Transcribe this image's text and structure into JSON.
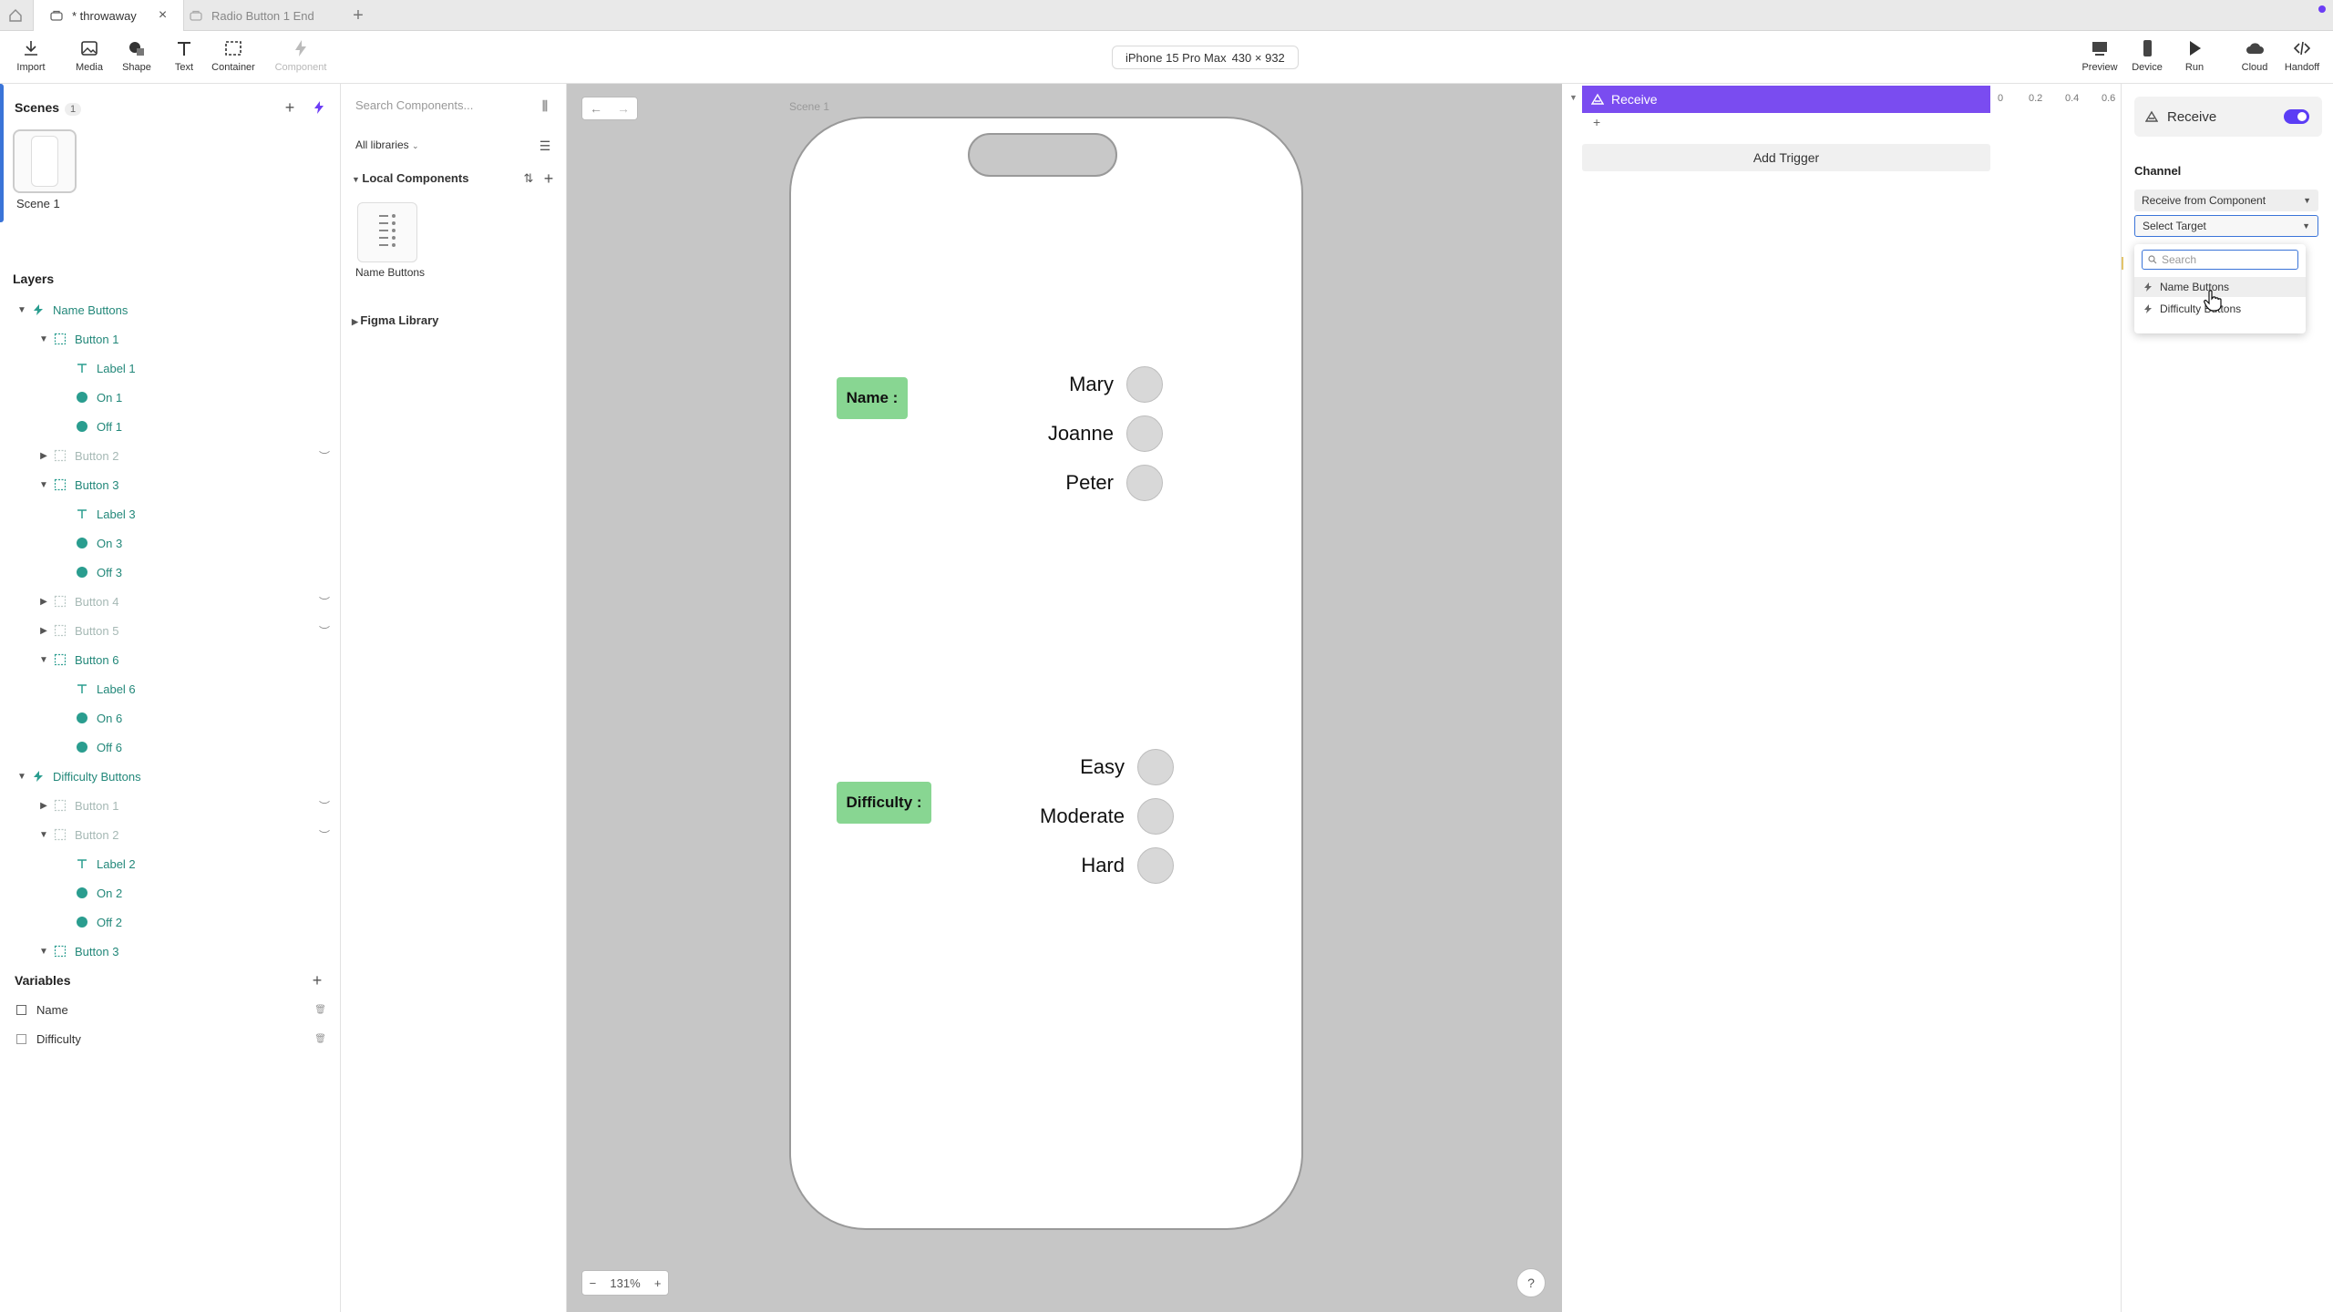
{
  "tabs": [
    {
      "label": "* throwaway",
      "active": true
    },
    {
      "label": "Radio Button 1 End",
      "active": false
    }
  ],
  "toolbar": {
    "tools": [
      "Import",
      "Media",
      "Shape",
      "Text",
      "Container",
      "Component"
    ],
    "device_name": "iPhone 15 Pro Max",
    "device_size": "430 × 932",
    "right_tools": [
      "Preview",
      "Device",
      "Run",
      "Cloud",
      "Handoff"
    ]
  },
  "scenes": {
    "title": "Scenes",
    "count": "1",
    "items": [
      "Scene 1"
    ]
  },
  "layers": {
    "title": "Layers",
    "rows": [
      {
        "name": "Name Buttons",
        "type": "component",
        "indent": 0,
        "expanded": true,
        "dim": false
      },
      {
        "name": "Button 1",
        "type": "frame",
        "indent": 1,
        "expanded": true,
        "dim": false
      },
      {
        "name": "Label 1",
        "type": "text",
        "indent": 2,
        "dim": false
      },
      {
        "name": "On 1",
        "type": "shape",
        "indent": 2,
        "dim": false
      },
      {
        "name": "Off 1",
        "type": "shape",
        "indent": 2,
        "dim": false
      },
      {
        "name": "Button 2",
        "type": "frame",
        "indent": 1,
        "expanded": false,
        "dim": true,
        "hidden": true
      },
      {
        "name": "Button 3",
        "type": "frame",
        "indent": 1,
        "expanded": true,
        "dim": false
      },
      {
        "name": "Label 3",
        "type": "text",
        "indent": 2,
        "dim": false
      },
      {
        "name": "On 3",
        "type": "shape",
        "indent": 2,
        "dim": false
      },
      {
        "name": "Off 3",
        "type": "shape",
        "indent": 2,
        "dim": false
      },
      {
        "name": "Button 4",
        "type": "frame",
        "indent": 1,
        "expanded": false,
        "dim": true,
        "hidden": true
      },
      {
        "name": "Button 5",
        "type": "frame",
        "indent": 1,
        "expanded": false,
        "dim": true,
        "hidden": true
      },
      {
        "name": "Button 6",
        "type": "frame",
        "indent": 1,
        "expanded": true,
        "dim": false
      },
      {
        "name": "Label 6",
        "type": "text",
        "indent": 2,
        "dim": false
      },
      {
        "name": "On 6",
        "type": "shape",
        "indent": 2,
        "dim": false
      },
      {
        "name": "Off 6",
        "type": "shape",
        "indent": 2,
        "dim": false
      },
      {
        "name": "Difficulty Buttons",
        "type": "component",
        "indent": 0,
        "expanded": true,
        "dim": false
      },
      {
        "name": "Button 1",
        "type": "frame",
        "indent": 1,
        "expanded": false,
        "dim": true,
        "hidden": true
      },
      {
        "name": "Button 2",
        "type": "frame",
        "indent": 1,
        "expanded": true,
        "dim": true,
        "hidden": true
      },
      {
        "name": "Label 2",
        "type": "text",
        "indent": 2,
        "dim": false
      },
      {
        "name": "On 2",
        "type": "shape",
        "indent": 2,
        "dim": false
      },
      {
        "name": "Off 2",
        "type": "shape",
        "indent": 2,
        "dim": false
      },
      {
        "name": "Button 3",
        "type": "frame",
        "indent": 1,
        "expanded": true,
        "dim": false
      }
    ]
  },
  "variables": {
    "title": "Variables",
    "items": [
      "Name",
      "Difficulty"
    ]
  },
  "components": {
    "search_placeholder": "Search Components...",
    "library_filter": "All libraries",
    "local_title": "Local Components",
    "items": [
      "Name Buttons"
    ],
    "figma_library": "Figma Library"
  },
  "canvas": {
    "scene_tag": "Scene 1",
    "zoom": "131%",
    "help": "?",
    "name_label": "Name :",
    "name_options": [
      "Mary",
      "Joanne",
      "Peter"
    ],
    "difficulty_label": "Difficulty :",
    "difficulty_options": [
      "Easy",
      "Moderate",
      "Hard"
    ]
  },
  "timeline": {
    "receive_label": "Receive",
    "ruler_ticks": [
      "0",
      "0.2",
      "0.4",
      "0.6"
    ],
    "add_trigger": "Add Trigger"
  },
  "properties": {
    "header": "Receive",
    "toggle_on": true,
    "channel_label": "Channel",
    "channel_value": "Receive from Component",
    "target_value": "Select Target",
    "dropdown": {
      "search_placeholder": "Search",
      "options": [
        "Name Buttons",
        "Difficulty Buttons"
      ],
      "hovered": "Name Buttons"
    }
  },
  "colors": {
    "accent_purple": "#7a4cf0",
    "teal": "#23887a",
    "green_label": "#88d692",
    "canvas_bg": "#c6c6c6",
    "focus_blue": "#3a74d8"
  }
}
